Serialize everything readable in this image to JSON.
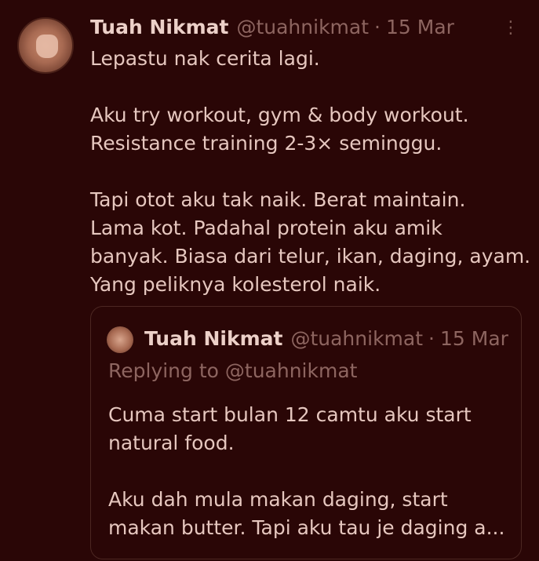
{
  "tweet": {
    "author_name": "Tuah Nikmat",
    "author_handle": "@tuahnikmat",
    "separator": "·",
    "date": "15 Mar",
    "more_icon": "⋮",
    "lines": [
      "Lepastu nak cerita lagi.",
      "",
      "Aku try workout, gym & body workout.",
      "Resistance training 2-3× seminggu.",
      "",
      "Tapi otot aku tak naik. Berat maintain.",
      "Lama kot. Padahal protein aku amik",
      "banyak. Biasa dari telur, ikan, daging, ayam.",
      "Yang peliknya kolesterol naik."
    ]
  },
  "quote": {
    "author_name": "Tuah Nikmat",
    "author_handle": "@tuahnikmat",
    "separator": "·",
    "date": "15 Mar",
    "replying_to": "Replying to @tuahnikmat",
    "lines": [
      "Cuma start bulan 12 camtu aku start",
      "natural food.",
      "",
      "Aku dah mula makan daging, start",
      "makan butter. Tapi aku tau je daging a..."
    ]
  },
  "colors": {
    "background": "#2a0606",
    "text": "#e6c7bf",
    "muted": "#8d6560",
    "border": "#4c2722"
  }
}
